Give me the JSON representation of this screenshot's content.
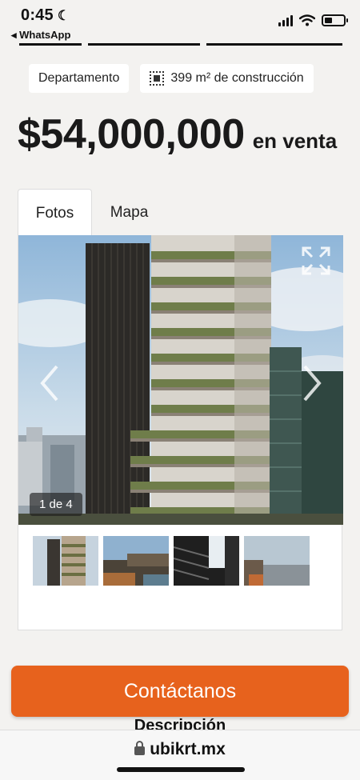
{
  "status_bar": {
    "time": "0:45",
    "moon_icon": "moon-icon",
    "back_app": "◂ WhatsApp"
  },
  "property": {
    "chips": [
      {
        "label": "Departamento"
      },
      {
        "label": "399 m² de construcción",
        "icon": "area-icon"
      }
    ],
    "price": "$54,000,000",
    "status": "en venta"
  },
  "tabs": [
    {
      "label": "Fotos",
      "active": true
    },
    {
      "label": "Mapa",
      "active": false
    }
  ],
  "gallery": {
    "counter": "1 de 4",
    "current": 1,
    "total": 4
  },
  "cta": {
    "label": "Contáctanos",
    "color": "#e7621d"
  },
  "section": {
    "heading": "Descripción"
  },
  "browser": {
    "url": "ubikrt.mx"
  }
}
